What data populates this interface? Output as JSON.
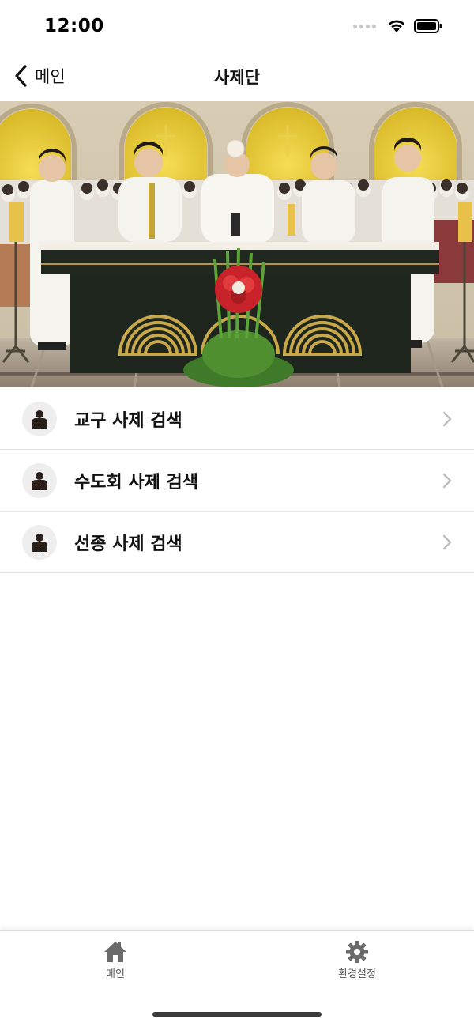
{
  "status_bar": {
    "time": "12:00",
    "icons": [
      "signal-dots-icon",
      "wifi-icon",
      "battery-icon"
    ]
  },
  "nav": {
    "back_label": "메인",
    "back_icon": "chevron-left-icon",
    "title": "사제단"
  },
  "hero": {
    "description_icon": "photo-mass-altar"
  },
  "menu": {
    "items": [
      {
        "label": "교구 사제 검색",
        "icon": "person-icon"
      },
      {
        "label": "수도회 사제 검색",
        "icon": "person-icon"
      },
      {
        "label": "선종 사제 검색",
        "icon": "person-icon"
      }
    ],
    "chevron_color": "#bdbdbd"
  },
  "tab_bar": {
    "items": [
      {
        "label": "메인",
        "icon": "home-icon"
      },
      {
        "label": "환경설정",
        "icon": "gear-icon"
      }
    ],
    "icon_color": "#6b6b6b"
  }
}
